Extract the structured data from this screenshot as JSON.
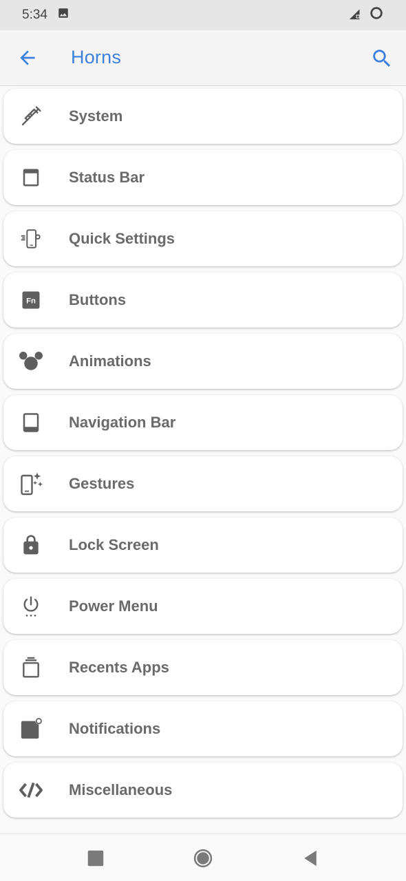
{
  "status_bar": {
    "time": "5:34"
  },
  "app_bar": {
    "title": "Horns",
    "back_icon": "arrow-back-icon",
    "search_icon": "search-icon"
  },
  "items": [
    {
      "label": "System",
      "icon": "syringe-icon"
    },
    {
      "label": "Status Bar",
      "icon": "status-bar-icon"
    },
    {
      "label": "Quick Settings",
      "icon": "phone-settings-icon"
    },
    {
      "label": "Buttons",
      "icon": "fn-key-icon"
    },
    {
      "label": "Animations",
      "icon": "mouse-ears-icon"
    },
    {
      "label": "Navigation Bar",
      "icon": "navigation-bar-icon"
    },
    {
      "label": "Gestures",
      "icon": "phone-sparkle-icon"
    },
    {
      "label": "Lock Screen",
      "icon": "lock-icon"
    },
    {
      "label": "Power Menu",
      "icon": "power-icon"
    },
    {
      "label": "Recents Apps",
      "icon": "recents-icon"
    },
    {
      "label": "Notifications",
      "icon": "notification-dot-icon"
    },
    {
      "label": "Miscellaneous",
      "icon": "code-icon"
    }
  ],
  "colors": {
    "accent": "#3d80de",
    "icon": "#5f5f5f",
    "label": "#6a6a6a"
  }
}
